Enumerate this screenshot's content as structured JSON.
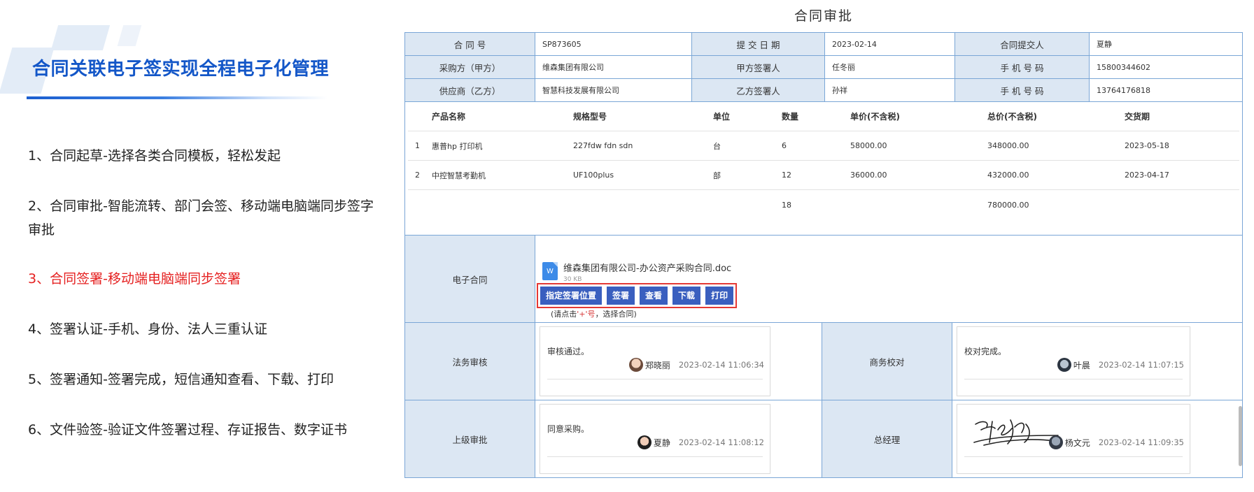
{
  "left": {
    "headline": "合同关联电子签实现全程电子化管理",
    "steps": [
      "1、合同起草-选择各类合同模板，轻松发起",
      "2、合同审批-智能流转、部门会签、移动端电脑端同步签字审批",
      "3、合同签署-移动端电脑端同步签署",
      "4、签署认证-手机、身份、法人三重认证",
      "5、签署通知-签署完成，短信通知查看、下载、打印",
      "6、文件验签-验证文件签署过程、存证报告、数字证书"
    ],
    "active_step": 3,
    "colors": {
      "headline": "#1457c8",
      "active": "#e52020"
    }
  },
  "page": {
    "title": "合同审批"
  },
  "info": {
    "contract_no_label": "合 同 号",
    "contract_no": "SP873605",
    "submit_date_label": "提 交 日 期",
    "submit_date": "2023-02-14",
    "submitter_label": "合同提交人",
    "submitter": "夏静",
    "buyer_label": "采购方（甲方）",
    "buyer": "维森集团有限公司",
    "buyer_signer_label": "甲方签署人",
    "buyer_signer": "任冬丽",
    "buyer_phone_label": "手 机 号 码",
    "buyer_phone": "15800344602",
    "supplier_label": "供应商（乙方）",
    "supplier": "智慧科技发展有限公司",
    "supplier_signer_label": "乙方签署人",
    "supplier_signer": "孙祥",
    "supplier_phone_label": "手 机 号 码",
    "supplier_phone": "13764176818"
  },
  "products": {
    "headers": [
      "",
      "产品名称",
      "规格型号",
      "单位",
      "数量",
      "单价(不含税)",
      "总价(不含税)",
      "交货期"
    ],
    "rows": [
      [
        "1",
        "惠普hp 打印机",
        "227fdw fdn sdn",
        "台",
        "6",
        "58000.00",
        "348000.00",
        "2023-05-18"
      ],
      [
        "2",
        "中控智慧考勤机",
        "UF100plus",
        "部",
        "12",
        "36000.00",
        "432000.00",
        "2023-04-17"
      ]
    ],
    "total_qty": "18",
    "total_amount": "780000.00"
  },
  "econtract": {
    "label": "电子合同",
    "file_icon": "W",
    "file_name": "维森集团有限公司-办公资产采购合同.doc",
    "file_size": "30 KB",
    "buttons": [
      "指定签署位置",
      "签署",
      "查看",
      "下载",
      "打印"
    ],
    "hint_prefix": "(请点击",
    "hint_plus": "'+'号",
    "hint_suffix": "，选择合同)"
  },
  "approvals": {
    "legal_label": "法务审核",
    "legal_text": "审核通过。",
    "legal_user": "郑晓丽",
    "legal_time": "2023-02-14 11:06:34",
    "biz_label": "商务校对",
    "biz_text": "校对完成。",
    "biz_user": "叶晨",
    "biz_time": "2023-02-14 11:07:15",
    "sup_label": "上级审批",
    "sup_text": "同意采购。",
    "sup_user": "夏静",
    "sup_time": "2023-02-14 11:08:12",
    "gm_label": "总经理",
    "gm_user": "杨文元",
    "gm_time": "2023-02-14 11:09:35"
  }
}
